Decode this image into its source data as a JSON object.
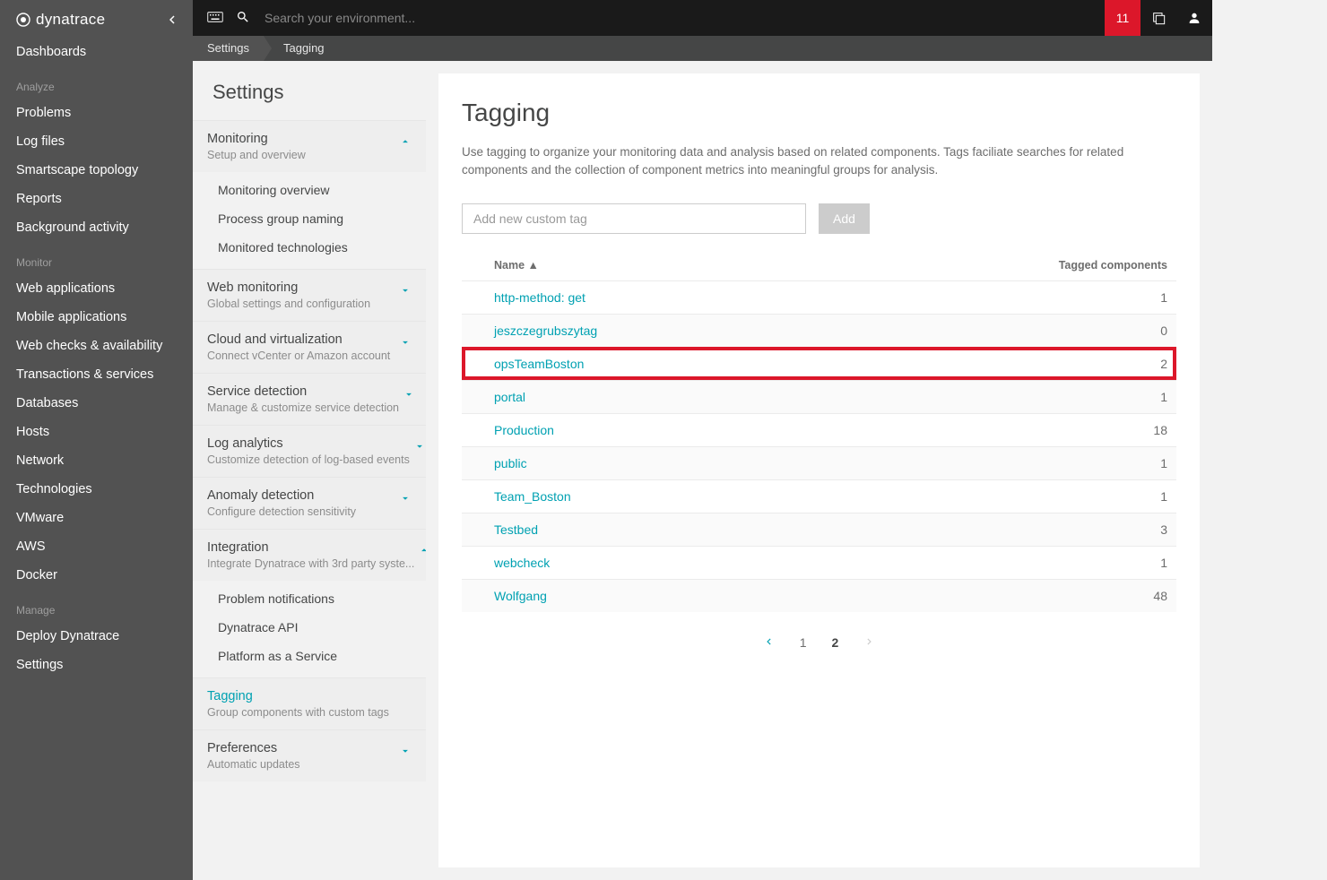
{
  "brand": "dynatrace",
  "topbar": {
    "search_placeholder": "Search your environment...",
    "notif_count": "11"
  },
  "breadcrumb": [
    "Settings",
    "Tagging"
  ],
  "nav": {
    "dashboards": "Dashboards",
    "groups": [
      "Analyze",
      "Monitor",
      "Manage"
    ],
    "analyze": [
      "Problems",
      "Log files",
      "Smartscape topology",
      "Reports",
      "Background activity"
    ],
    "monitor": [
      "Web applications",
      "Mobile applications",
      "Web checks & availability",
      "Transactions & services",
      "Databases",
      "Hosts",
      "Network",
      "Technologies",
      "VMware",
      "AWS",
      "Docker"
    ],
    "manage": [
      "Deploy Dynatrace",
      "Settings"
    ]
  },
  "settings_panel": {
    "title": "Settings",
    "sections": [
      {
        "head": "Monitoring",
        "sub": "Setup and overview",
        "items": [
          "Monitoring overview",
          "Process group naming",
          "Monitored technologies"
        ]
      },
      {
        "head": "Web monitoring",
        "sub": "Global settings and configuration"
      },
      {
        "head": "Cloud and virtualization",
        "sub": "Connect vCenter or Amazon account"
      },
      {
        "head": "Service detection",
        "sub": "Manage & customize service detection"
      },
      {
        "head": "Log analytics",
        "sub": "Customize detection of log-based events"
      },
      {
        "head": "Anomaly detection",
        "sub": "Configure detection sensitivity"
      },
      {
        "head": "Integration",
        "sub": "Integrate Dynatrace with 3rd party syste...",
        "items": [
          "Problem notifications",
          "Dynatrace API",
          "Platform as a Service"
        ]
      },
      {
        "head": "Tagging",
        "sub": "Group components with custom tags"
      },
      {
        "head": "Preferences",
        "sub": "Automatic updates"
      }
    ]
  },
  "page": {
    "title": "Tagging",
    "description": "Use tagging to organize your monitoring data and analysis based on related components. Tags faciliate searches for related components and the collection of component metrics into meaningful groups for analysis.",
    "add_placeholder": "Add new custom tag",
    "add_button": "Add",
    "columns": {
      "name": "Name ▲",
      "count": "Tagged components"
    },
    "tags": [
      {
        "name": "http-method: get",
        "count": 1,
        "highlight": false
      },
      {
        "name": "jeszczegrubszytag",
        "count": 0,
        "highlight": false
      },
      {
        "name": "opsTeamBoston",
        "count": 2,
        "highlight": true
      },
      {
        "name": "portal",
        "count": 1,
        "highlight": false
      },
      {
        "name": "Production",
        "count": 18,
        "highlight": false
      },
      {
        "name": "public",
        "count": 1,
        "highlight": false
      },
      {
        "name": "Team_Boston",
        "count": 1,
        "highlight": false
      },
      {
        "name": "Testbed",
        "count": 3,
        "highlight": false
      },
      {
        "name": "webcheck",
        "count": 1,
        "highlight": false
      },
      {
        "name": "Wolfgang",
        "count": 48,
        "highlight": false
      }
    ],
    "pager": {
      "pages": [
        "1",
        "2"
      ],
      "current": 2
    }
  }
}
